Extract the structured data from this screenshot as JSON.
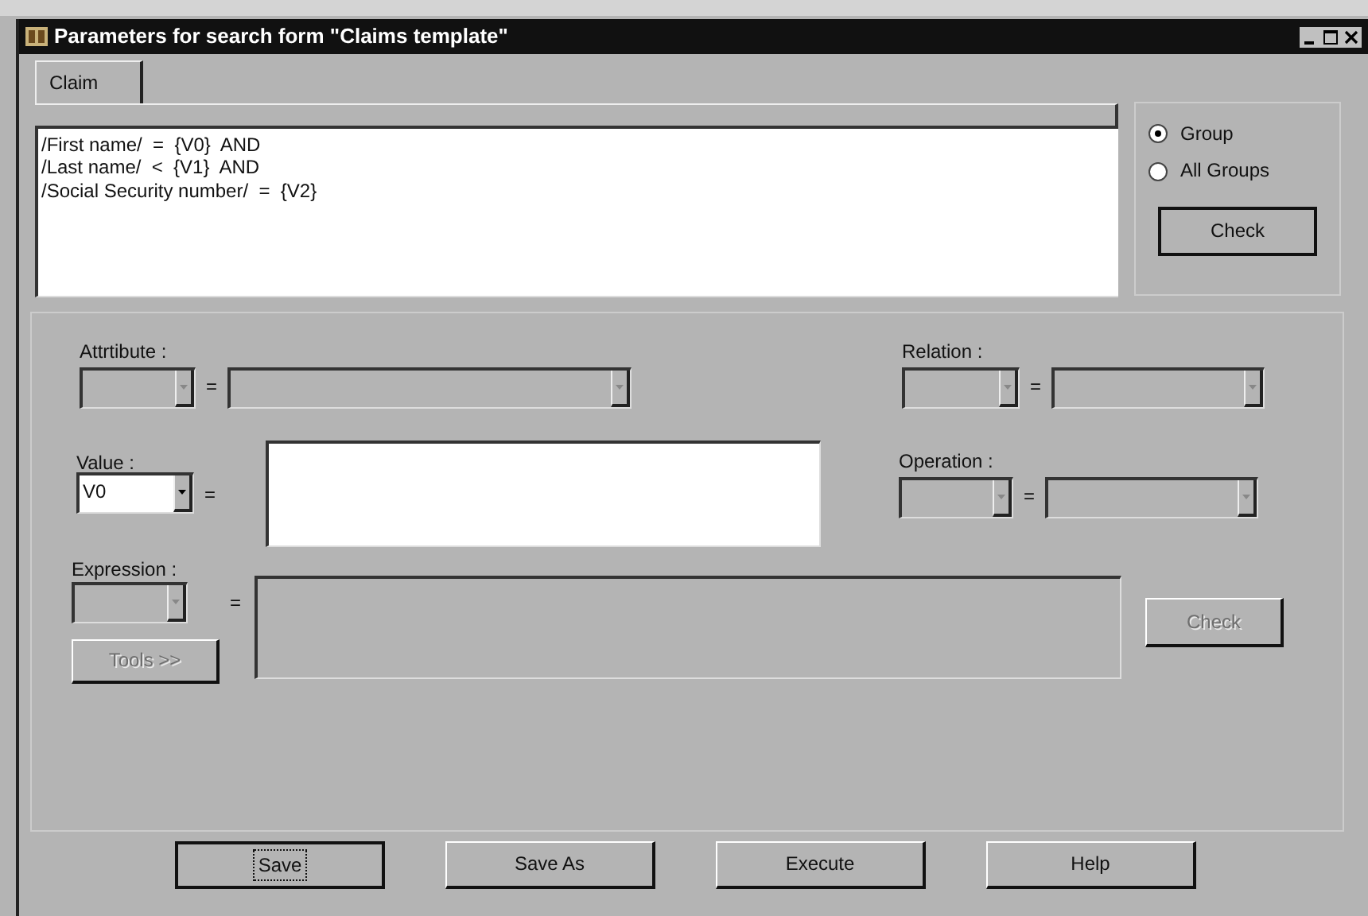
{
  "window": {
    "title": "Parameters for search form \"Claims template\""
  },
  "tabs": [
    {
      "label": "Claim",
      "selected": true
    }
  ],
  "query": {
    "lines": [
      "/First name/  =  {V0}  AND",
      "/Last name/  <  {V1}  AND",
      "/Social Security number/  =  {V2}"
    ]
  },
  "scope": {
    "options": [
      {
        "label": "Group",
        "selected": true
      },
      {
        "label": "All Groups",
        "selected": false
      }
    ],
    "check_button": {
      "label": "Check"
    }
  },
  "criteria": {
    "attribute": {
      "label": "Attrtibute :",
      "operator": "=",
      "disabled": true
    },
    "relation": {
      "label": "Relation :",
      "operator": "=",
      "disabled": true
    },
    "value": {
      "label": "Value :",
      "selection": "V0",
      "operator": "=",
      "disabled": false
    },
    "operation": {
      "label": "Operation :",
      "operator": "=",
      "disabled": true
    },
    "expression": {
      "label": "Expression :",
      "operator": "=",
      "disabled": true
    },
    "tools_button": {
      "label": "Tools >>",
      "disabled": true
    },
    "check_button": {
      "label": "Check",
      "disabled": true
    }
  },
  "buttons": [
    {
      "label": "Save",
      "focused": true
    },
    {
      "label": "Save As",
      "focused": false
    },
    {
      "label": "Execute",
      "focused": false
    },
    {
      "label": "Help",
      "focused": false
    }
  ]
}
